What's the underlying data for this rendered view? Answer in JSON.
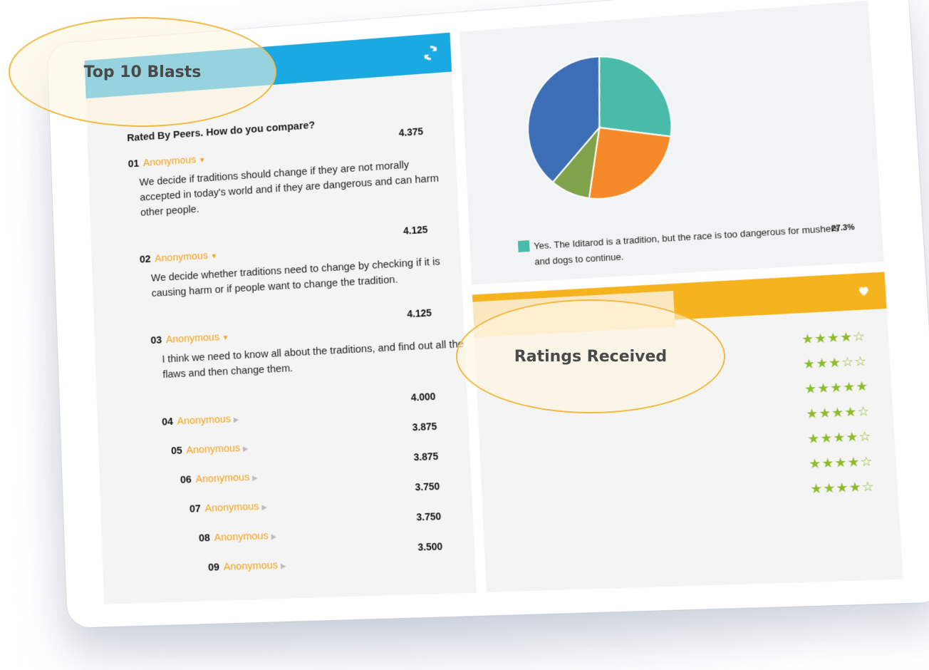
{
  "blasts_panel": {
    "title": "Top 10 Blasts",
    "subtitle": "Rated By Peers. How do you compare?",
    "items": [
      {
        "rank": "01",
        "author": "Anonymous",
        "score": "4.375",
        "expanded": true,
        "text": "We decide if traditions should change if they are not morally accepted in today's world and if they are dangerous and can harm other people."
      },
      {
        "rank": "02",
        "author": "Anonymous",
        "score": "4.125",
        "expanded": true,
        "text": "We decide whether traditions need to change by checking if it is causing harm or if people want to change the tradition."
      },
      {
        "rank": "03",
        "author": "Anonymous",
        "score": "4.125",
        "expanded": true,
        "text": "I think we need to know all about the traditions, and find out all the flaws and then change them."
      },
      {
        "rank": "04",
        "author": "Anonymous",
        "score": "4.000",
        "expanded": false,
        "text": ""
      },
      {
        "rank": "05",
        "author": "Anonymous",
        "score": "3.875",
        "expanded": false,
        "text": ""
      },
      {
        "rank": "06",
        "author": "Anonymous",
        "score": "3.875",
        "expanded": false,
        "text": ""
      },
      {
        "rank": "07",
        "author": "Anonymous",
        "score": "3.750",
        "expanded": false,
        "text": ""
      },
      {
        "rank": "08",
        "author": "Anonymous",
        "score": "3.750",
        "expanded": false,
        "text": ""
      },
      {
        "rank": "09",
        "author": "Anonymous",
        "score": "3.500",
        "expanded": false,
        "text": ""
      }
    ]
  },
  "poll_panel": {
    "chart_data": {
      "type": "pie",
      "slices": [
        {
          "color": "#49bba8",
          "value": 27.3
        },
        {
          "color": "#f5892a",
          "value": 25.0
        },
        {
          "color": "#7fa24a",
          "value": 9.0
        },
        {
          "color": "#3d6fb6",
          "value": 38.7
        }
      ]
    },
    "legend": {
      "text": "Yes. The Iditarod is a tradition, but the race is too dangerous for mushers and dogs to continue.",
      "percent": "27.3%",
      "color": "#49bba8"
    }
  },
  "ratings_panel": {
    "title": "Ratings Received",
    "rows": [
      4,
      3,
      5,
      4,
      4,
      4,
      4
    ]
  },
  "icons": {
    "refresh": "refresh-icon",
    "heart": "heart-icon"
  },
  "colors": {
    "blue_header": "#1aa9e1",
    "orange_header": "#f5b31e",
    "author": "#f5a21b",
    "star": "#8dbb2a"
  }
}
